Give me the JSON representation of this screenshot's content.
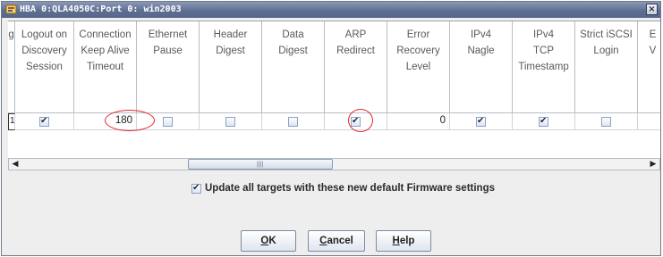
{
  "window": {
    "title": "HBA 0:QLA4050C:Port 0: win2003",
    "close_glyph": "×"
  },
  "table": {
    "columns": [
      {
        "label_lines": [
          "ng"
        ]
      },
      {
        "label_lines": [
          "Logout on",
          "Discovery",
          "Session"
        ]
      },
      {
        "label_lines": [
          "Connection",
          "Keep Alive",
          "Timeout"
        ]
      },
      {
        "label_lines": [
          "Ethernet",
          "Pause"
        ]
      },
      {
        "label_lines": [
          "Header",
          "Digest"
        ]
      },
      {
        "label_lines": [
          "Data",
          "Digest"
        ]
      },
      {
        "label_lines": [
          "ARP",
          "Redirect"
        ]
      },
      {
        "label_lines": [
          "Error",
          "Recovery",
          "Level"
        ]
      },
      {
        "label_lines": [
          "IPv4",
          "Nagle"
        ]
      },
      {
        "label_lines": [
          "IPv4",
          "TCP",
          "Timestamp"
        ]
      },
      {
        "label_lines": [
          "Strict iSCSI",
          "Login"
        ]
      },
      {
        "label_lines": [
          "E",
          "V"
        ]
      }
    ],
    "row": {
      "first_cell": "1",
      "logout_on_discovery_session": true,
      "connection_keep_alive_timeout": "180",
      "ethernet_pause": false,
      "header_digest": false,
      "data_digest": false,
      "arp_redirect": true,
      "error_recovery_level": "0",
      "ipv4_nagle": true,
      "ipv4_tcp_timestamp": true,
      "strict_iscsi_login": false
    }
  },
  "scrollbar": {
    "left_arrow": "◀",
    "right_arrow": "▶",
    "grip": "||||"
  },
  "update_option": {
    "checked": true,
    "label": "Update all targets with these new default Firmware settings"
  },
  "buttons": {
    "ok": {
      "mnemonic": "O",
      "rest": "K"
    },
    "cancel": {
      "mnemonic": "C",
      "rest": "ancel"
    },
    "help": {
      "mnemonic": "H",
      "rest": "elp"
    }
  },
  "annotation_color": "#e0292e"
}
